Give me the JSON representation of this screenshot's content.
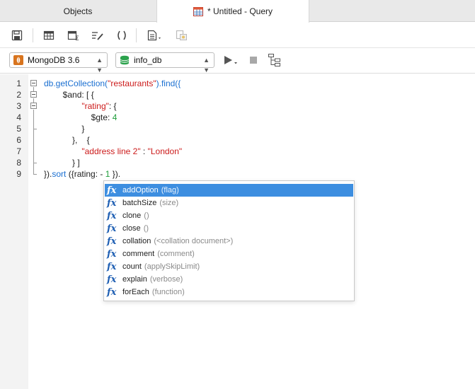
{
  "tabs": [
    {
      "label": "Objects"
    },
    {
      "label": "* Untitled - Query",
      "icon": "table-query-icon"
    }
  ],
  "toolbar": {
    "buttons": [
      "save-icon",
      "new-table-icon",
      "beautify-icon",
      "format-icon",
      "brackets-icon",
      "snippet-icon",
      "export-icon"
    ]
  },
  "connection": {
    "value": "MongoDB 3.6",
    "icon": "mongodb-leaf-icon"
  },
  "database": {
    "value": "info_db",
    "icon": "database-icon"
  },
  "editor": {
    "line_numbers": [
      "1",
      "2",
      "3",
      "4",
      "5",
      "6",
      "7",
      "8",
      "9"
    ],
    "lines": [
      [
        {
          "t": "db.getCollection(",
          "c": "kw"
        },
        {
          "t": "\"restaurants\"",
          "c": "str"
        },
        {
          "t": ").find({",
          "c": "kw"
        }
      ],
      [
        {
          "t": "        $and: [ {",
          "c": ""
        }
      ],
      [
        {
          "t": "                ",
          "c": ""
        },
        {
          "t": "\"rating\"",
          "c": "str"
        },
        {
          "t": ": {",
          "c": ""
        }
      ],
      [
        {
          "t": "                    $gte: ",
          "c": ""
        },
        {
          "t": "4",
          "c": "num"
        }
      ],
      [
        {
          "t": "                }",
          "c": ""
        }
      ],
      [
        {
          "t": "            },    {",
          "c": ""
        }
      ],
      [
        {
          "t": "                ",
          "c": ""
        },
        {
          "t": "\"address line 2\"",
          "c": "str"
        },
        {
          "t": " : ",
          "c": ""
        },
        {
          "t": "\"London\"",
          "c": "str"
        }
      ],
      [
        {
          "t": "            } ]",
          "c": ""
        }
      ],
      [
        {
          "t": "}).",
          "c": ""
        },
        {
          "t": "sort",
          "c": "kw"
        },
        {
          "t": " ({rating: - ",
          "c": ""
        },
        {
          "t": "1",
          "c": "num"
        },
        {
          "t": " }).",
          "c": ""
        }
      ]
    ]
  },
  "autocomplete": {
    "items": [
      {
        "name": "addOption",
        "hint": "(flag)",
        "selected": true
      },
      {
        "name": "batchSize",
        "hint": "(size)",
        "selected": false
      },
      {
        "name": "clone",
        "hint": "()",
        "selected": false
      },
      {
        "name": "close",
        "hint": "()",
        "selected": false
      },
      {
        "name": "collation",
        "hint": "(<collation document>)",
        "selected": false
      },
      {
        "name": "comment",
        "hint": "(comment)",
        "selected": false
      },
      {
        "name": "count",
        "hint": "(applySkipLimit)",
        "selected": false
      },
      {
        "name": "explain",
        "hint": "(verbose)",
        "selected": false
      },
      {
        "name": "forEach",
        "hint": "(function)",
        "selected": false
      }
    ],
    "fx_symbol": "fx"
  },
  "colors": {
    "selection": "#3d8ee0",
    "keyword": "#1a6fd1",
    "string": "#cc1b1b",
    "number": "#1e9d3a"
  }
}
